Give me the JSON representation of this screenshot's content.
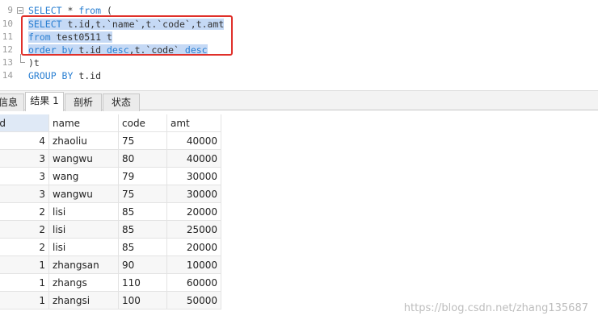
{
  "editor": {
    "lines": [
      {
        "no": "9",
        "kw1": "SELECT",
        "mid": " * ",
        "kw2": "from",
        "tail": " ("
      },
      {
        "no": "10",
        "kw1": "SELECT",
        "mid": " t.id,t.`name`,t.`code`,t.amt"
      },
      {
        "no": "11",
        "kw1": "from",
        "mid": " test0511 t"
      },
      {
        "no": "12",
        "kw1": "order by",
        "mid": " t.id ",
        "kw2": "desc",
        "tail": ",t.`code` ",
        "kw3": "desc"
      },
      {
        "no": "13",
        "mid": ")t"
      },
      {
        "no": "14",
        "kw1": "GROUP BY",
        "mid": " t.id"
      }
    ]
  },
  "tabs": [
    {
      "label": "信息"
    },
    {
      "label": "结果 1"
    },
    {
      "label": "剖析"
    },
    {
      "label": "状态"
    }
  ],
  "grid": {
    "columns": [
      "id",
      "name",
      "code",
      "amt"
    ],
    "rows": [
      [
        "4",
        "zhaoliu",
        "75",
        "40000"
      ],
      [
        "3",
        "wangwu",
        "80",
        "40000"
      ],
      [
        "3",
        "wang",
        "79",
        "30000"
      ],
      [
        "3",
        "wangwu",
        "75",
        "30000"
      ],
      [
        "2",
        "lisi",
        "85",
        "20000"
      ],
      [
        "2",
        "lisi",
        "85",
        "25000"
      ],
      [
        "2",
        "lisi",
        "85",
        "20000"
      ],
      [
        "1",
        "zhangsan",
        "90",
        "10000"
      ],
      [
        "1",
        "zhangs",
        "110",
        "60000"
      ],
      [
        "1",
        "zhangsi",
        "100",
        "50000"
      ]
    ]
  },
  "watermark": "https://blog.csdn.net/zhang135687",
  "colors": {
    "keyword": "#2a7fd2",
    "selection": "#c5d9f5",
    "highlight_border": "#e0302a"
  }
}
